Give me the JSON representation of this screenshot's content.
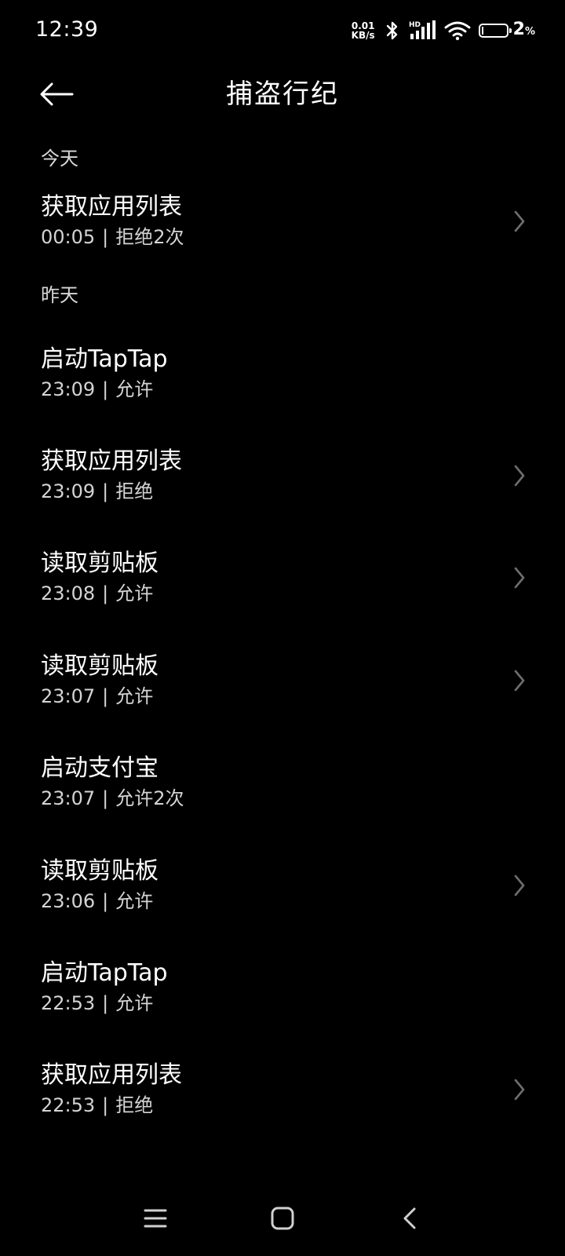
{
  "status_bar": {
    "time": "12:39",
    "net_speed_value": "0.01",
    "net_speed_unit": "KB/s",
    "icons": [
      "bluetooth-icon",
      "hd-signal-icon",
      "wifi-icon",
      "battery-icon"
    ],
    "hd_label": "HD",
    "battery_percent": "2",
    "battery_percent_sign": "%",
    "battery_level": 0.02
  },
  "header": {
    "title": "捕盗行纪",
    "back_icon": "arrow-left-icon"
  },
  "sections": [
    {
      "label": "今天",
      "items": [
        {
          "title": "获取应用列表",
          "time": "00:05",
          "result": "拒绝2次",
          "has_chevron": true
        }
      ]
    },
    {
      "label": "昨天",
      "items": [
        {
          "title": "启动TapTap",
          "time": "23:09",
          "result": "允许",
          "has_chevron": false
        },
        {
          "title": "获取应用列表",
          "time": "23:09",
          "result": "拒绝",
          "has_chevron": true
        },
        {
          "title": "读取剪贴板",
          "time": "23:08",
          "result": "允许",
          "has_chevron": true
        },
        {
          "title": "读取剪贴板",
          "time": "23:07",
          "result": "允许",
          "has_chevron": true
        },
        {
          "title": "启动支付宝",
          "time": "23:07",
          "result": "允许2次",
          "has_chevron": false
        },
        {
          "title": "读取剪贴板",
          "time": "23:06",
          "result": "允许",
          "has_chevron": true
        },
        {
          "title": "启动TapTap",
          "time": "22:53",
          "result": "允许",
          "has_chevron": false
        },
        {
          "title": "获取应用列表",
          "time": "22:53",
          "result": "拒绝",
          "has_chevron": true
        }
      ]
    }
  ],
  "meta_separator": "|",
  "nav_bar": {
    "buttons": [
      "menu-icon",
      "home-icon",
      "back-icon"
    ]
  },
  "colors": {
    "background": "#000000",
    "text_primary": "#ffffff",
    "text_secondary": "#d4d4d4",
    "chevron": "#6e6e6e"
  }
}
